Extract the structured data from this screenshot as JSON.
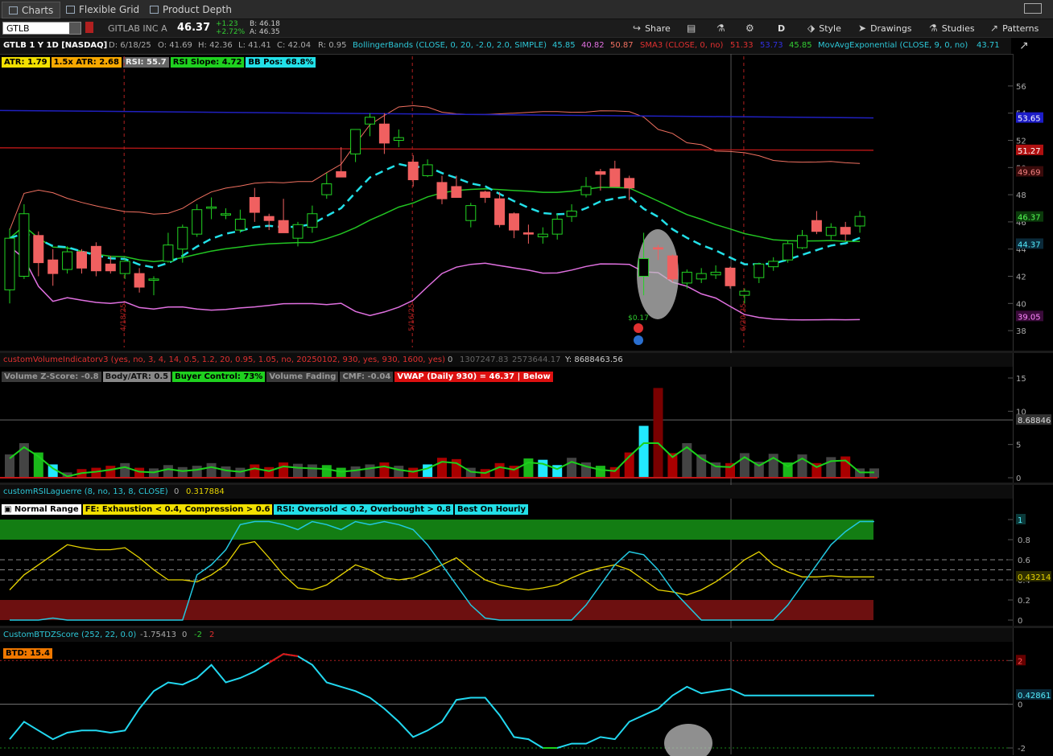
{
  "tabs": [
    {
      "label": "Charts",
      "icon": "chart-icon",
      "active": true
    },
    {
      "label": "Flexible Grid",
      "icon": "grid-icon",
      "active": false
    },
    {
      "label": "Product Depth",
      "icon": "depth-icon",
      "active": false
    }
  ],
  "toolbar": {
    "symbol": "GTLB",
    "company": "GITLAB INC A",
    "last": "46.37",
    "change": "+1.23",
    "change_pct": "+2.72%",
    "bid": "B: 46.18",
    "ask": "A: 46.35",
    "share": "Share",
    "period": "D",
    "style": "Style",
    "drawings": "Drawings",
    "studies": "Studies",
    "patterns": "Patterns"
  },
  "info": {
    "title": "GTLB 1 Y 1D [NASDAQ]",
    "date": "D: 6/18/25",
    "open": "O: 41.69",
    "high": "H: 42.36",
    "low": "L: 41.41",
    "close": "C: 42.04",
    "range": "R: 0.95",
    "bb": "BollingerBands (CLOSE, 0, 20, -2.0, 2.0, SIMPLE)",
    "bb_mid": "45.85",
    "bb_low": "40.82",
    "bb_up": "50.87",
    "sma": "SMA3 (CLOSE, 0, no)",
    "sma_val": "51.33",
    "v2": "53.73",
    "v3": "45.85",
    "ema": "MovAvgExponential (CLOSE, 9, 0, no)",
    "ema_val": "43.71"
  },
  "badges": [
    {
      "text": "ATR: 1.79",
      "bg": "#f2e000",
      "fg": "#000"
    },
    {
      "text": "1.5x ATR: 2.68",
      "bg": "#f7a800",
      "fg": "#000"
    },
    {
      "text": "RSI: 55.7",
      "bg": "#666666",
      "fg": "#eee"
    },
    {
      "text": "RSI Slope: 4.72",
      "bg": "#1fd11f",
      "fg": "#000"
    },
    {
      "text": "BB Pos: 68.8%",
      "bg": "#22e0e8",
      "fg": "#000"
    }
  ],
  "price_axis": {
    "ticks": [
      "56",
      "54",
      "52",
      "50",
      "48",
      "46",
      "44",
      "42",
      "40",
      "38"
    ],
    "labels": [
      {
        "text": "53.65",
        "bg": "#1c1cc8",
        "fg": "#fff"
      },
      {
        "text": "51.27",
        "bg": "#b01010",
        "fg": "#fff"
      },
      {
        "text": "49.69",
        "bg": "#3a0b0b",
        "fg": "#f08080"
      },
      {
        "text": "46.37",
        "bg": "#0b3a0b",
        "fg": "#5f5"
      },
      {
        "text": "44.37",
        "bg": "#0b2a3a",
        "fg": "#5ef"
      },
      {
        "text": "39.05",
        "bg": "#3a0b3a",
        "fg": "#f8f"
      }
    ]
  },
  "chart_annotations": {
    "earnings": "$0.17",
    "dates": [
      "4/18/25",
      "5/16/25",
      "6/20/25"
    ]
  },
  "volume": {
    "header": "customVolumeIndicatorv3 (yes, no, 3, 4, 14, 0.5, 1.2, 20, 0.95, 1.05, no, 20250102, 930, yes, 930, 1600, yes)",
    "v0": "0",
    "v1": "1307247.83",
    "v2": "2573644.17",
    "y": "Y: 8688463.56",
    "badges": [
      {
        "text": "Volume Z-Score: -0.8",
        "bg": "#3a3a3a",
        "fg": "#999"
      },
      {
        "text": "Body/ATR: 0.5",
        "bg": "#888888",
        "fg": "#111"
      },
      {
        "text": "Buyer Control: 73%",
        "bg": "#1fd11f",
        "fg": "#000"
      },
      {
        "text": "Volume Fading",
        "bg": "#3a3a3a",
        "fg": "#999"
      },
      {
        "text": "CMF: -0.04",
        "bg": "#3a3a3a",
        "fg": "#999"
      },
      {
        "text": "VWAP (Daily 930) = 46.37 | Below",
        "bg": "#dd1010",
        "fg": "#fff"
      }
    ],
    "ticks": [
      "15",
      "10",
      "5",
      "0"
    ],
    "label": "8.68846"
  },
  "rsi": {
    "header": "customRSILaguerre (8, no, 13, 8, CLOSE)",
    "v0": "0",
    "v1": "0.317884",
    "badges": [
      {
        "text": "Normal Range",
        "bg": "#ffffff",
        "fg": "#000",
        "check": true
      },
      {
        "text": "FE: Exhaustion < 0.4, Compression > 0.6",
        "bg": "#f2e000",
        "fg": "#000"
      },
      {
        "text": "RSI: Oversold < 0.2, Overbought > 0.8",
        "bg": "#22e0e8",
        "fg": "#000"
      },
      {
        "text": "Best On Hourly",
        "bg": "#22e0e8",
        "fg": "#000"
      }
    ],
    "ticks": [
      "1",
      "0.8",
      "0.6",
      "0.4",
      "0.2",
      "0"
    ],
    "label": "0.43214"
  },
  "btd": {
    "header": "CustomBTDZScore (252, 22, 0.0)",
    "v0": "-1.75413",
    "v1": "0",
    "v2": "-2",
    "v3": "2",
    "badge": "BTD: 15.4",
    "ticks": [
      "2",
      "0",
      "-2"
    ],
    "label": "0.42861"
  },
  "colors": {
    "up": "#22d422",
    "down": "#f06060",
    "ema": "#22e0e8",
    "bb_mid": "#22c422",
    "bb_upper": "#f07060",
    "bb_lower": "#e070e0",
    "sma_long": "#2020c0",
    "sma_red": "#c01818"
  },
  "chart_data": {
    "type": "candlestick",
    "candles": [
      {
        "o": 41.0,
        "h": 45.5,
        "l": 40.0,
        "c": 44.8
      },
      {
        "o": 42.0,
        "h": 47.3,
        "l": 41.8,
        "c": 46.6
      },
      {
        "o": 45.0,
        "h": 45.3,
        "l": 42.0,
        "c": 43.0
      },
      {
        "o": 43.2,
        "h": 44.0,
        "l": 41.3,
        "c": 42.2
      },
      {
        "o": 42.5,
        "h": 44.2,
        "l": 42.2,
        "c": 43.8
      },
      {
        "o": 43.8,
        "h": 44.0,
        "l": 42.2,
        "c": 42.6
      },
      {
        "o": 44.2,
        "h": 44.5,
        "l": 42.0,
        "c": 42.4
      },
      {
        "o": 42.9,
        "h": 43.5,
        "l": 42.2,
        "c": 42.4
      },
      {
        "o": 42.2,
        "h": 43.3,
        "l": 41.8,
        "c": 43.1
      },
      {
        "o": 42.2,
        "h": 42.6,
        "l": 40.8,
        "c": 41.2
      },
      {
        "o": 41.7,
        "h": 42.0,
        "l": 40.6,
        "c": 41.8
      },
      {
        "o": 43.1,
        "h": 45.2,
        "l": 43.0,
        "c": 44.3
      },
      {
        "o": 44.0,
        "h": 45.8,
        "l": 43.0,
        "c": 45.6
      },
      {
        "o": 45.1,
        "h": 47.3,
        "l": 44.9,
        "c": 46.9
      },
      {
        "o": 47.0,
        "h": 47.8,
        "l": 46.2,
        "c": 47.1
      },
      {
        "o": 46.5,
        "h": 47.0,
        "l": 46.2,
        "c": 46.6
      },
      {
        "o": 45.4,
        "h": 46.9,
        "l": 45.2,
        "c": 46.2
      },
      {
        "o": 47.8,
        "h": 48.5,
        "l": 46.0,
        "c": 46.7
      },
      {
        "o": 46.4,
        "h": 46.6,
        "l": 45.4,
        "c": 46.1
      },
      {
        "o": 46.1,
        "h": 47.7,
        "l": 45.6,
        "c": 45.2
      },
      {
        "o": 44.8,
        "h": 46.0,
        "l": 44.2,
        "c": 45.8
      },
      {
        "o": 45.6,
        "h": 47.2,
        "l": 45.2,
        "c": 46.6
      },
      {
        "o": 48.0,
        "h": 49.6,
        "l": 47.7,
        "c": 48.8
      },
      {
        "o": 49.7,
        "h": 51.5,
        "l": 49.6,
        "c": 49.3
      },
      {
        "o": 51.0,
        "h": 52.3,
        "l": 50.4,
        "c": 52.8
      },
      {
        "o": 53.2,
        "h": 54.0,
        "l": 52.3,
        "c": 53.7
      },
      {
        "o": 53.2,
        "h": 54.0,
        "l": 51.0,
        "c": 51.8
      },
      {
        "o": 52.0,
        "h": 52.8,
        "l": 51.5,
        "c": 52.2
      },
      {
        "o": 50.4,
        "h": 50.9,
        "l": 48.6,
        "c": 49.1
      },
      {
        "o": 49.4,
        "h": 50.6,
        "l": 49.3,
        "c": 50.2
      },
      {
        "o": 48.9,
        "h": 49.4,
        "l": 47.3,
        "c": 47.7
      },
      {
        "o": 48.6,
        "h": 49.4,
        "l": 47.9,
        "c": 47.8
      },
      {
        "o": 46.1,
        "h": 47.4,
        "l": 45.6,
        "c": 47.2
      },
      {
        "o": 48.2,
        "h": 48.3,
        "l": 47.4,
        "c": 47.8
      },
      {
        "o": 47.7,
        "h": 48.2,
        "l": 45.6,
        "c": 45.8
      },
      {
        "o": 46.6,
        "h": 46.7,
        "l": 44.8,
        "c": 45.4
      },
      {
        "o": 45.2,
        "h": 45.8,
        "l": 44.4,
        "c": 45.1
      },
      {
        "o": 44.9,
        "h": 45.6,
        "l": 44.4,
        "c": 45.1
      },
      {
        "o": 45.1,
        "h": 46.6,
        "l": 44.7,
        "c": 46.2
      },
      {
        "o": 46.4,
        "h": 47.3,
        "l": 46.0,
        "c": 46.8
      },
      {
        "o": 48.0,
        "h": 49.3,
        "l": 47.8,
        "c": 48.6
      },
      {
        "o": 49.7,
        "h": 49.9,
        "l": 48.3,
        "c": 49.5
      },
      {
        "o": 49.9,
        "h": 50.5,
        "l": 48.6,
        "c": 48.6
      },
      {
        "o": 49.2,
        "h": 49.4,
        "l": 47.6,
        "c": 48.5
      },
      {
        "o": 42.0,
        "h": 45.2,
        "l": 40.6,
        "c": 43.3
      },
      {
        "o": 44.1,
        "h": 44.3,
        "l": 43.2,
        "c": 44.0
      },
      {
        "o": 43.5,
        "h": 43.6,
        "l": 41.6,
        "c": 41.8
      },
      {
        "o": 41.5,
        "h": 42.5,
        "l": 41.1,
        "c": 42.3
      },
      {
        "o": 41.8,
        "h": 42.6,
        "l": 41.5,
        "c": 42.2
      },
      {
        "o": 42.1,
        "h": 42.8,
        "l": 41.8,
        "c": 42.3
      },
      {
        "o": 42.6,
        "h": 42.7,
        "l": 41.1,
        "c": 41.3
      },
      {
        "o": 40.6,
        "h": 41.1,
        "l": 40.0,
        "c": 40.9
      },
      {
        "o": 41.9,
        "h": 43.0,
        "l": 41.5,
        "c": 42.9
      },
      {
        "o": 42.7,
        "h": 43.4,
        "l": 42.4,
        "c": 43.1
      },
      {
        "o": 43.2,
        "h": 44.6,
        "l": 43.0,
        "c": 44.4
      },
      {
        "o": 44.1,
        "h": 45.4,
        "l": 44.0,
        "c": 45.0
      },
      {
        "o": 46.1,
        "h": 46.8,
        "l": 45.1,
        "c": 45.3
      },
      {
        "o": 45.0,
        "h": 45.9,
        "l": 44.7,
        "c": 45.6
      },
      {
        "o": 45.6,
        "h": 46.0,
        "l": 44.6,
        "c": 45.1
      },
      {
        "o": 45.7,
        "h": 46.8,
        "l": 45.2,
        "c": 46.4
      }
    ],
    "ylim": [
      37,
      57
    ],
    "volume": [
      3.5,
      5.2,
      3.8,
      2.0,
      0.8,
      1.3,
      1.5,
      1.8,
      2.2,
      1.5,
      1.4,
      1.9,
      1.6,
      1.8,
      2.2,
      1.7,
      1.5,
      2.0,
      1.6,
      2.3,
      2.1,
      2.0,
      1.9,
      1.5,
      1.7,
      2.0,
      2.3,
      1.8,
      1.5,
      2.0,
      3.0,
      2.8,
      1.5,
      1.3,
      2.2,
      1.8,
      2.9,
      2.7,
      1.9,
      3.0,
      2.3,
      1.8,
      1.6,
      3.8,
      7.8,
      13.5,
      3.7,
      5.2,
      3.5,
      2.3,
      2.2,
      3.7,
      2.4,
      3.6,
      2.3,
      3.5,
      2.2,
      3.1,
      3.2,
      1.4,
      1.4
    ],
    "rsi_laguerre": [
      0.0,
      0.0,
      0.0,
      0.02,
      0.0,
      0.0,
      0.0,
      0.0,
      0.0,
      0.0,
      0.0,
      0.0,
      0.0,
      0.45,
      0.55,
      0.7,
      0.95,
      0.98,
      0.98,
      0.95,
      0.9,
      0.98,
      0.95,
      0.9,
      0.98,
      0.95,
      0.98,
      0.95,
      0.9,
      0.75,
      0.55,
      0.35,
      0.15,
      0.02,
      0.0,
      0.0,
      0.0,
      0.0,
      0.0,
      0.0,
      0.15,
      0.35,
      0.55,
      0.68,
      0.65,
      0.5,
      0.3,
      0.15,
      0.0,
      0.0,
      0.0,
      0.0,
      0.0,
      0.0,
      0.15,
      0.35,
      0.55,
      0.75,
      0.88,
      0.98,
      0.98
    ],
    "fe": [
      0.3,
      0.45,
      0.55,
      0.65,
      0.75,
      0.72,
      0.7,
      0.7,
      0.72,
      0.62,
      0.5,
      0.4,
      0.4,
      0.38,
      0.45,
      0.55,
      0.75,
      0.78,
      0.62,
      0.45,
      0.32,
      0.3,
      0.35,
      0.45,
      0.55,
      0.5,
      0.42,
      0.4,
      0.42,
      0.48,
      0.55,
      0.62,
      0.5,
      0.4,
      0.35,
      0.32,
      0.3,
      0.32,
      0.35,
      0.42,
      0.48,
      0.52,
      0.55,
      0.5,
      0.4,
      0.3,
      0.28,
      0.25,
      0.3,
      0.38,
      0.48,
      0.6,
      0.68,
      0.55,
      0.48,
      0.43,
      0.43,
      0.44,
      0.43,
      0.43,
      0.43
    ],
    "btd": [
      -1.6,
      -0.8,
      -1.2,
      -1.6,
      -1.3,
      -1.2,
      -1.2,
      -1.3,
      -1.2,
      -0.2,
      0.6,
      1.0,
      0.9,
      1.2,
      1.8,
      1.0,
      1.2,
      1.5,
      1.9,
      2.3,
      2.2,
      1.8,
      1.0,
      0.8,
      0.6,
      0.3,
      -0.2,
      -0.8,
      -1.5,
      -1.2,
      -0.8,
      0.2,
      0.3,
      0.3,
      -0.5,
      -1.5,
      -1.6,
      -2.0,
      -2.0,
      -1.8,
      -1.8,
      -1.5,
      -1.6,
      -0.8,
      -0.5,
      -0.2,
      0.4,
      0.8,
      0.5,
      0.6,
      0.7,
      0.4,
      0.4,
      0.4,
      0.4,
      0.4,
      0.4,
      0.4,
      0.4,
      0.4,
      0.4
    ],
    "btd_ylim": [
      -2,
      2.6
    ]
  }
}
